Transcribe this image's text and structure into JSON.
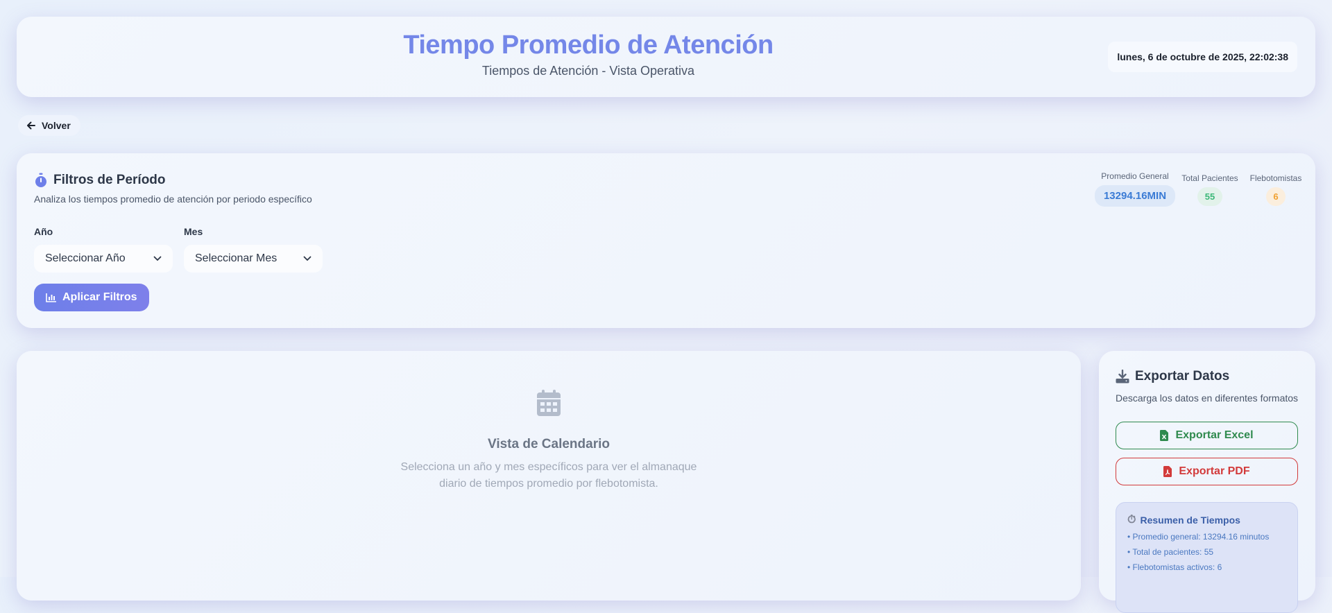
{
  "header": {
    "title": "Tiempo Promedio de Atención",
    "subtitle": "Tiempos de Atención - Vista Operativa",
    "datetime": "lunes, 6 de octubre de 2025, 22:02:38"
  },
  "nav": {
    "back_label": "Volver"
  },
  "filters": {
    "title": "Filtros de Período",
    "description": "Analiza los tiempos promedio de atención por periodo específico",
    "year_label": "Año",
    "year_value": "Seleccionar Año",
    "month_label": "Mes",
    "month_value": "Seleccionar Mes",
    "apply_label": "Aplicar Filtros"
  },
  "stats": {
    "average": {
      "label": "Promedio General",
      "value": "13294.16MIN",
      "color": "#3a7bd5"
    },
    "patients": {
      "label": "Total Pacientes",
      "value": "55",
      "color": "#3cb878"
    },
    "phlebotomists": {
      "label": "Flebotomistas",
      "value": "6",
      "color": "#f0a030"
    }
  },
  "calendar": {
    "title": "Vista de Calendario",
    "description": "Selecciona un año y mes específicos para ver el almanaque diario de tiempos promedio por flebotomista."
  },
  "export": {
    "title": "Exportar Datos",
    "description": "Descarga los datos en diferentes formatos",
    "excel_label": "Exportar Excel",
    "pdf_label": "Exportar PDF",
    "excel_color": "#2f8a4e",
    "pdf_color": "#d23a3a"
  },
  "summary": {
    "title": "Resumen de Tiempos",
    "items": [
      "• Promedio general: 13294.16 minutos",
      "• Total de pacientes: 55",
      "• Flebotomistas activos: 6"
    ]
  }
}
